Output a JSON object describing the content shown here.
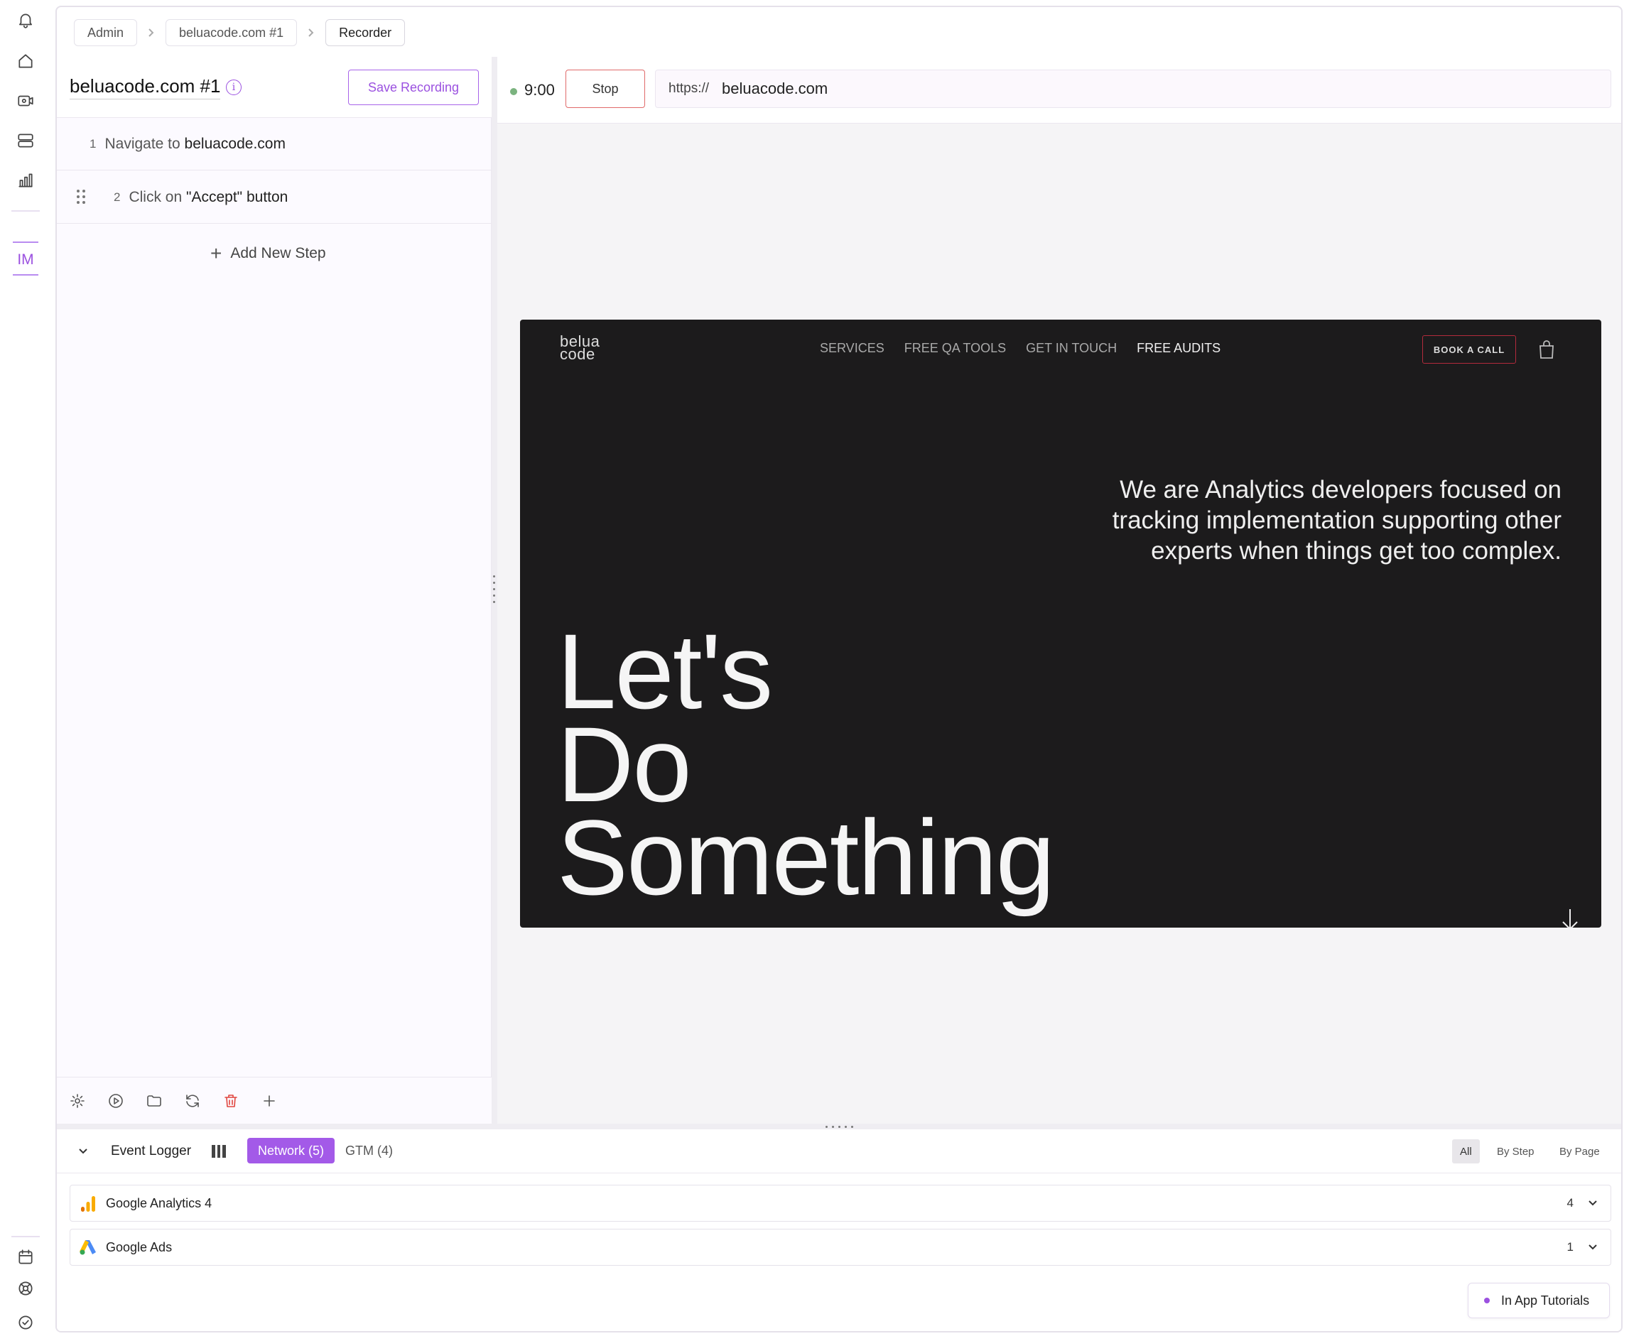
{
  "sidebar": {
    "top_icons": [
      "bell-icon",
      "home-icon",
      "video-icon",
      "server-icon",
      "chart-icon"
    ],
    "user_initials": "IM",
    "bottom_icons": [
      "calendar-icon",
      "support-icon",
      "shield-check-icon"
    ]
  },
  "breadcrumb": {
    "items": [
      "Admin",
      "beluacode.com #1",
      "Recorder"
    ]
  },
  "recording": {
    "title": "beluacode.com #1",
    "save_label": "Save Recording",
    "steps": [
      {
        "num": "1",
        "action": "Navigate to",
        "target": "beluacode.com"
      },
      {
        "num": "2",
        "action": "Click on",
        "target": "\"Accept\" button"
      }
    ],
    "add_step_label": "Add New Step"
  },
  "recorder": {
    "timer": "9:00",
    "stop_label": "Stop",
    "url_protocol": "https://",
    "url_host": "beluacode.com"
  },
  "preview": {
    "logo_line1": "belua",
    "logo_line2": "code",
    "nav": [
      "SERVICES",
      "FREE QA TOOLS",
      "GET IN TOUCH",
      "FREE AUDITS"
    ],
    "book_label": "BOOK A CALL",
    "tagline_line1": "We are Analytics developers focused on",
    "tagline_line2": "tracking implementation supporting other",
    "tagline_line3": "experts when things get too complex.",
    "hero_line1": "Let's",
    "hero_line2": "Do",
    "hero_line3": "Something"
  },
  "logger": {
    "title": "Event Logger",
    "tab_network": "Network (5)",
    "tab_gtm": "GTM (4)",
    "filters": [
      "All",
      "By Step",
      "By Page"
    ],
    "rows": [
      {
        "name": "Google Analytics 4",
        "count": "4"
      },
      {
        "name": "Google Ads",
        "count": "1"
      }
    ]
  },
  "tutorials_label": "In App Tutorials",
  "colors": {
    "accent": "#9b51e0",
    "stop_border": "#e06a6a",
    "preview_bg": "#1c1b1c",
    "recording_dot": "#7bb37f"
  }
}
